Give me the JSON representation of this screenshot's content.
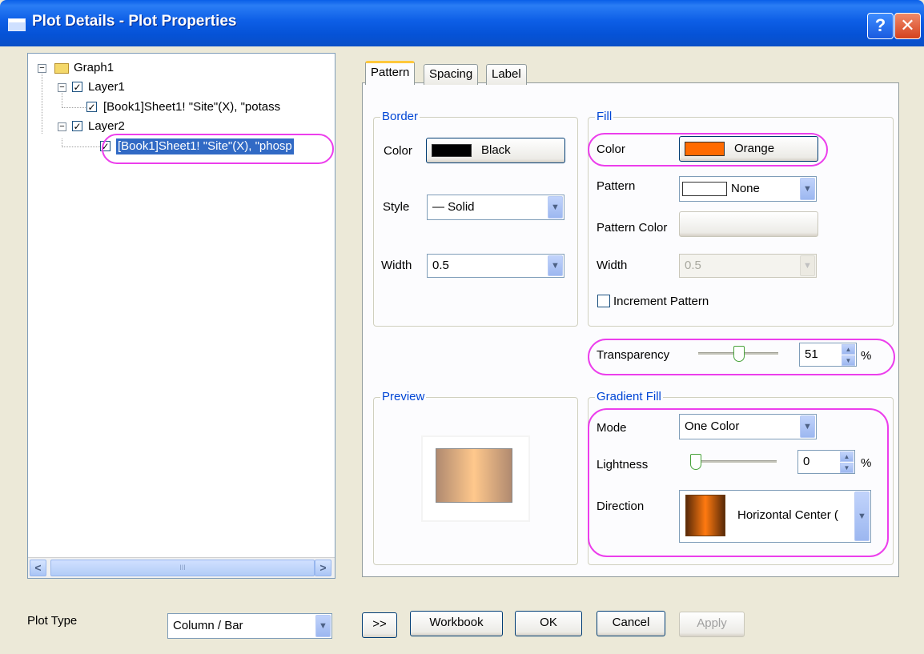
{
  "window": {
    "title": "Plot Details - Plot Properties",
    "help_label": "?",
    "close_label": "✕"
  },
  "tree": {
    "root": "Graph1",
    "layer1": "Layer1",
    "layer1_item": "[Book1]Sheet1! \"Site\"(X), \"potass",
    "layer2": "Layer2",
    "layer2_item": "[Book1]Sheet1! \"Site\"(X), \"phosp",
    "scroll_left": "<",
    "scroll_right": ">",
    "scroll_grip": "III"
  },
  "tabs": [
    "Pattern",
    "Spacing",
    "Label"
  ],
  "border": {
    "group_label": "Border",
    "color_label": "Color",
    "color_value": "Black",
    "color_hex": "#000000",
    "style_label": "Style",
    "style_value": "—  Solid",
    "width_label": "Width",
    "width_value": "0.5"
  },
  "fill": {
    "group_label": "Fill",
    "color_label": "Color",
    "color_value": "Orange",
    "color_hex": "#ff6a00",
    "pattern_label": "Pattern",
    "pattern_value": "None",
    "pattern_color_label": "Pattern Color",
    "width_label": "Width",
    "width_value": "0.5",
    "increment_label": "Increment Pattern"
  },
  "transparency": {
    "label": "Transparency",
    "value": "51",
    "unit": "%",
    "level": 0.51
  },
  "preview": {
    "group_label": "Preview"
  },
  "gradient": {
    "group_label": "Gradient Fill",
    "mode_label": "Mode",
    "mode_value": "One Color",
    "lightness_label": "Lightness",
    "lightness_value": "0",
    "lightness_unit": "%",
    "direction_label": "Direction",
    "direction_value": "Horizontal Center ("
  },
  "bottom": {
    "plot_type_label": "Plot Type",
    "plot_type_value": "Column / Bar",
    "expand_label": ">>",
    "workbook_label": "Workbook",
    "ok_label": "OK",
    "cancel_label": "Cancel",
    "apply_label": "Apply"
  },
  "colors": {
    "highlight": "#ec3eec",
    "group_label": "#0046d5",
    "selection": "#316ac5"
  }
}
